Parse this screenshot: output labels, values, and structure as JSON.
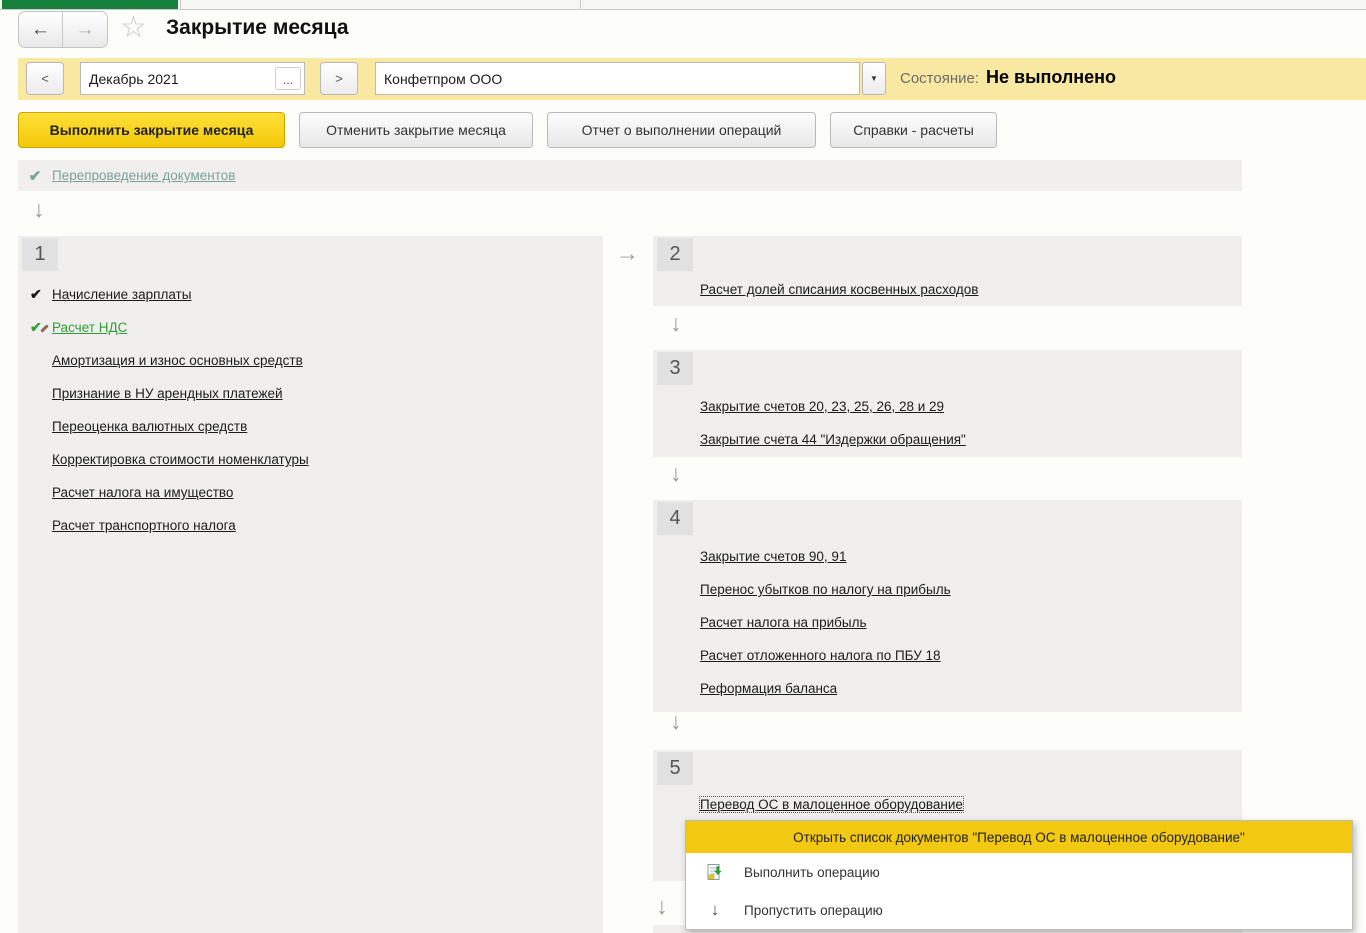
{
  "window": {
    "title": "Закрытие месяца"
  },
  "icons": {
    "back_arrow": "←",
    "forward_arrow": "→",
    "star": "☆",
    "down_arrow": "↓",
    "right_arrow": "→",
    "check": "✔",
    "ellipsis": "...",
    "dropdown": "▼"
  },
  "toolbar": {
    "prev_label": "<",
    "next_label": ">",
    "period_value": "Декабрь 2021",
    "company_value": "Конфетпром ООО",
    "status_label": "Состояние:",
    "status_value": "Не выполнено"
  },
  "actions": {
    "perform": "Выполнить закрытие месяца",
    "cancel": "Отменить закрытие месяца",
    "report": "Отчет о выполнении операций",
    "references": "Справки - расчеты"
  },
  "reposting": {
    "label": "Перепроведение документов"
  },
  "groups": [
    {
      "number": "1",
      "items": [
        {
          "label": "Начисление зарплаты",
          "check": "black"
        },
        {
          "label": "Расчет НДС",
          "check": "green-pencil"
        },
        {
          "label": "Амортизация и износ основных средств",
          "check": "none"
        },
        {
          "label": "Признание в НУ арендных платежей",
          "check": "none"
        },
        {
          "label": "Переоценка валютных средств",
          "check": "none"
        },
        {
          "label": "Корректировка стоимости номенклатуры",
          "check": "none"
        },
        {
          "label": "Расчет налога на имущество",
          "check": "none"
        },
        {
          "label": "Расчет транспортного налога",
          "check": "none"
        }
      ]
    },
    {
      "number": "2",
      "items": [
        {
          "label": "Расчет долей списания косвенных расходов",
          "check": "none"
        }
      ]
    },
    {
      "number": "3",
      "items": [
        {
          "label": "Закрытие счетов 20, 23, 25, 26, 28 и 29",
          "check": "none"
        },
        {
          "label": "Закрытие счета 44 \"Издержки обращения\"",
          "check": "none"
        }
      ]
    },
    {
      "number": "4",
      "items": [
        {
          "label": "Закрытие счетов 90, 91",
          "check": "none"
        },
        {
          "label": "Перенос убытков по налогу на прибыль",
          "check": "none"
        },
        {
          "label": "Расчет налога на прибыль",
          "check": "none"
        },
        {
          "label": "Расчет отложенного налога по ПБУ 18",
          "check": "none"
        },
        {
          "label": "Реформация баланса",
          "check": "none"
        }
      ]
    },
    {
      "number": "5",
      "items": [
        {
          "label": "Перевод ОС в малоценное оборудование",
          "check": "none",
          "focused": true
        }
      ]
    }
  ],
  "context_menu": {
    "open_list": "Открыть список документов \"Перевод ОС в малоценное оборудование\"",
    "perform_operation": "Выполнить операцию",
    "skip_operation": "Пропустить операцию"
  },
  "colors": {
    "accent_green": "#16813d",
    "toolbar_yellow": "#f8e8a2",
    "primary_button_yellow": "#f2c808",
    "menu_highlight_yellow": "#f2c811",
    "panel_gray": "#f0efee",
    "done_green": "#2f9e34",
    "reposting_teal": "#7ba19a"
  }
}
